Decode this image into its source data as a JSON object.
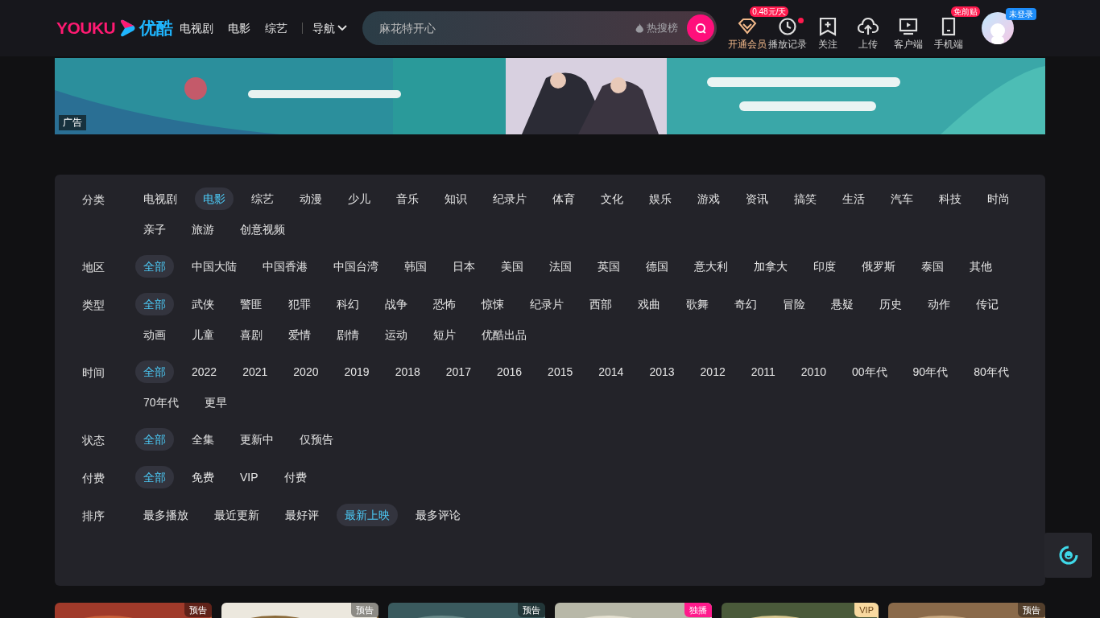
{
  "logo": {
    "latin": "YOUKU",
    "chinese": "优酷"
  },
  "nav": [
    {
      "label": "电视剧"
    },
    {
      "label": "电影"
    },
    {
      "label": "综艺"
    }
  ],
  "nav_menu": {
    "label": "导航"
  },
  "search": {
    "placeholder": "麻花特开心",
    "hot": "热搜榜"
  },
  "header_actions": [
    {
      "kind": "vip",
      "label": "开通会员",
      "badge": "0.48元/天"
    },
    {
      "kind": "history",
      "label": "播放记录",
      "dot": true
    },
    {
      "kind": "follow",
      "label": "关注"
    },
    {
      "kind": "upload",
      "label": "上传"
    },
    {
      "kind": "client",
      "label": "客户端"
    },
    {
      "kind": "mobile",
      "label": "手机端",
      "badge": "免前贴"
    }
  ],
  "user": {
    "badge": "未登录"
  },
  "banner": {
    "kind": "picture",
    "tag": "广告"
  },
  "filters": [
    {
      "label": "分类",
      "options": [
        {
          "text": "电视剧",
          "selected": false
        },
        {
          "text": "电影",
          "selected": true
        },
        {
          "text": "综艺",
          "selected": false
        },
        {
          "text": "动漫",
          "selected": false
        },
        {
          "text": "少儿",
          "selected": false
        },
        {
          "text": "音乐",
          "selected": false
        },
        {
          "text": "知识",
          "selected": false
        },
        {
          "text": "纪录片",
          "selected": false
        },
        {
          "text": "体育",
          "selected": false
        },
        {
          "text": "文化",
          "selected": false
        },
        {
          "text": "娱乐",
          "selected": false
        },
        {
          "text": "游戏",
          "selected": false
        },
        {
          "text": "资讯",
          "selected": false
        },
        {
          "text": "搞笑",
          "selected": false
        },
        {
          "text": "生活",
          "selected": false
        },
        {
          "text": "汽车",
          "selected": false
        },
        {
          "text": "科技",
          "selected": false
        },
        {
          "text": "时尚",
          "selected": false
        },
        {
          "text": "亲子",
          "selected": false
        },
        {
          "text": "旅游",
          "selected": false
        },
        {
          "text": "创意视频",
          "selected": false
        }
      ]
    },
    {
      "label": "地区",
      "options": [
        {
          "text": "全部",
          "selected": true
        },
        {
          "text": "中国大陆",
          "selected": false
        },
        {
          "text": "中国香港",
          "selected": false
        },
        {
          "text": "中国台湾",
          "selected": false
        },
        {
          "text": "韩国",
          "selected": false
        },
        {
          "text": "日本",
          "selected": false
        },
        {
          "text": "美国",
          "selected": false
        },
        {
          "text": "法国",
          "selected": false
        },
        {
          "text": "英国",
          "selected": false
        },
        {
          "text": "德国",
          "selected": false
        },
        {
          "text": "意大利",
          "selected": false
        },
        {
          "text": "加拿大",
          "selected": false
        },
        {
          "text": "印度",
          "selected": false
        },
        {
          "text": "俄罗斯",
          "selected": false
        },
        {
          "text": "泰国",
          "selected": false
        },
        {
          "text": "其他",
          "selected": false
        }
      ]
    },
    {
      "label": "类型",
      "options": [
        {
          "text": "全部",
          "selected": true
        },
        {
          "text": "武侠",
          "selected": false
        },
        {
          "text": "警匪",
          "selected": false
        },
        {
          "text": "犯罪",
          "selected": false
        },
        {
          "text": "科幻",
          "selected": false
        },
        {
          "text": "战争",
          "selected": false
        },
        {
          "text": "恐怖",
          "selected": false
        },
        {
          "text": "惊悚",
          "selected": false
        },
        {
          "text": "纪录片",
          "selected": false
        },
        {
          "text": "西部",
          "selected": false
        },
        {
          "text": "戏曲",
          "selected": false
        },
        {
          "text": "歌舞",
          "selected": false
        },
        {
          "text": "奇幻",
          "selected": false
        },
        {
          "text": "冒险",
          "selected": false
        },
        {
          "text": "悬疑",
          "selected": false
        },
        {
          "text": "历史",
          "selected": false
        },
        {
          "text": "动作",
          "selected": false
        },
        {
          "text": "传记",
          "selected": false
        },
        {
          "text": "动画",
          "selected": false
        },
        {
          "text": "儿童",
          "selected": false
        },
        {
          "text": "喜剧",
          "selected": false
        },
        {
          "text": "爱情",
          "selected": false
        },
        {
          "text": "剧情",
          "selected": false
        },
        {
          "text": "运动",
          "selected": false
        },
        {
          "text": "短片",
          "selected": false
        },
        {
          "text": "优酷出品",
          "selected": false
        }
      ]
    },
    {
      "label": "时间",
      "options": [
        {
          "text": "全部",
          "selected": true
        },
        {
          "text": "2022",
          "selected": false
        },
        {
          "text": "2021",
          "selected": false
        },
        {
          "text": "2020",
          "selected": false
        },
        {
          "text": "2019",
          "selected": false
        },
        {
          "text": "2018",
          "selected": false
        },
        {
          "text": "2017",
          "selected": false
        },
        {
          "text": "2016",
          "selected": false
        },
        {
          "text": "2015",
          "selected": false
        },
        {
          "text": "2014",
          "selected": false
        },
        {
          "text": "2013",
          "selected": false
        },
        {
          "text": "2012",
          "selected": false
        },
        {
          "text": "2011",
          "selected": false
        },
        {
          "text": "2010",
          "selected": false
        },
        {
          "text": "00年代",
          "selected": false
        },
        {
          "text": "90年代",
          "selected": false
        },
        {
          "text": "80年代",
          "selected": false
        },
        {
          "text": "70年代",
          "selected": false
        },
        {
          "text": "更早",
          "selected": false
        }
      ]
    },
    {
      "label": "状态",
      "options": [
        {
          "text": "全部",
          "selected": true
        },
        {
          "text": "全集",
          "selected": false
        },
        {
          "text": "更新中",
          "selected": false
        },
        {
          "text": "仅预告",
          "selected": false
        }
      ]
    },
    {
      "label": "付费",
      "options": [
        {
          "text": "全部",
          "selected": true
        },
        {
          "text": "免费",
          "selected": false
        },
        {
          "text": "VIP",
          "selected": false
        },
        {
          "text": "付费",
          "selected": false
        }
      ]
    },
    {
      "label": "排序",
      "options": [
        {
          "text": "最多播放",
          "selected": false
        },
        {
          "text": "最近更新",
          "selected": false
        },
        {
          "text": "最好评",
          "selected": false
        },
        {
          "text": "最新上映",
          "selected": true
        },
        {
          "text": "最多评论",
          "selected": false
        }
      ]
    }
  ],
  "cards": [
    {
      "badge": "预告",
      "kind": "trailer"
    },
    {
      "badge": "预告",
      "kind": "trailer"
    },
    {
      "badge": "预告",
      "kind": "trailer"
    },
    {
      "badge": "独播",
      "kind": "exclusive"
    },
    {
      "badge": "VIP",
      "kind": "vip"
    },
    {
      "badge": "预告",
      "kind": "trailer"
    }
  ]
}
